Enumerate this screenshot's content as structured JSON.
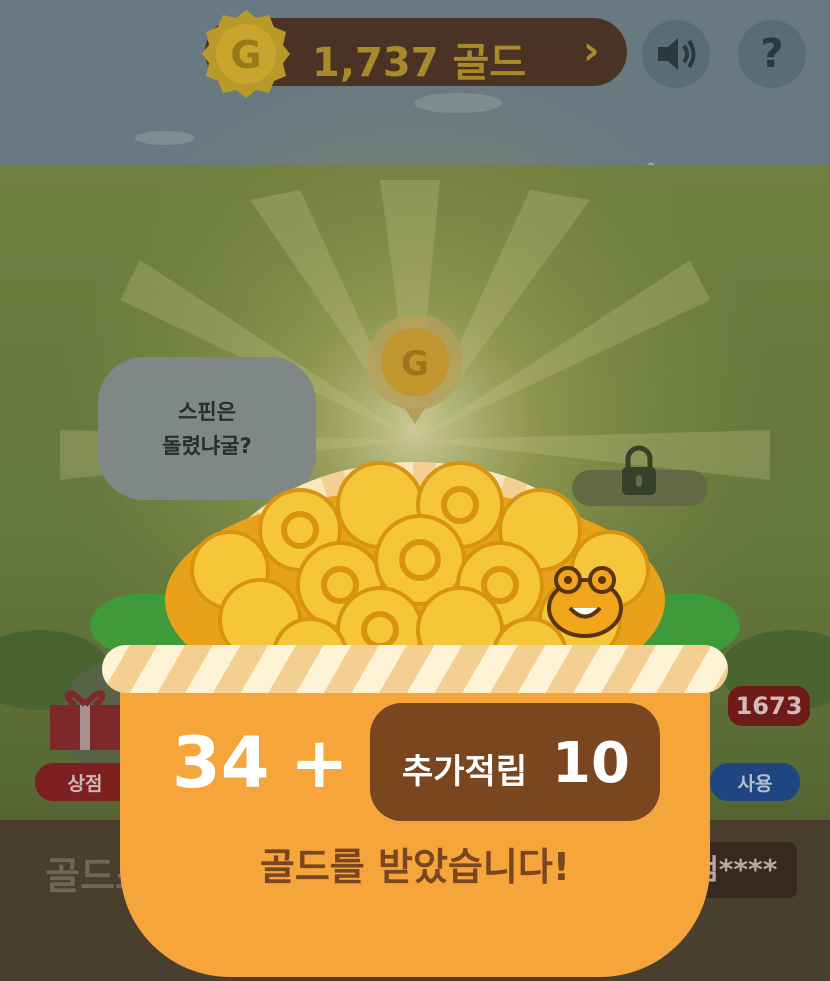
{
  "header": {
    "gold_amount_label": "1,737 골드",
    "coin_letter": "G",
    "chevron": "›",
    "sound_icon": "speaker-icon",
    "help_label": "?"
  },
  "scene": {
    "speech_bubble_line1": "스핀은",
    "speech_bubble_line2": "돌렸냐굴?",
    "shop_label": "상점",
    "use_label": "사용",
    "use_count_badge": "1673",
    "bottom_left_text": "골드스",
    "bottom_right_text": "엄****"
  },
  "reward": {
    "base_amount": "34",
    "plus_sign": "+",
    "bonus_label": "추가적립",
    "bonus_amount": "10",
    "message": "골드를 받았습니다!"
  },
  "colors": {
    "basket": "#f5a53a",
    "bonus_box": "#7a4620",
    "gold": "#f5b820",
    "header_bar": "#4a3325"
  }
}
